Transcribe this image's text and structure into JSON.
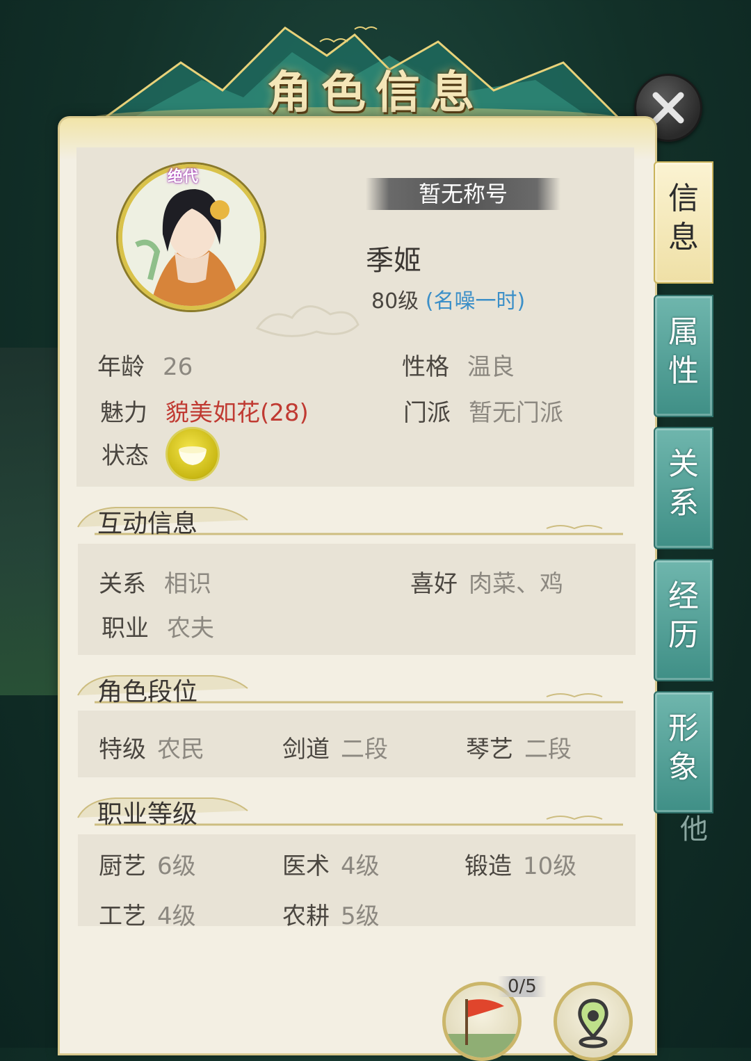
{
  "window": {
    "title": "角色信息"
  },
  "profile": {
    "rarity": "绝代",
    "title_banner": "暂无称号",
    "name": "季姬",
    "level": "80级",
    "fame": "(名噪一时)"
  },
  "attributes": {
    "age_label": "年龄",
    "age_value": "26",
    "personality_label": "性格",
    "personality_value": "温良",
    "charm_label": "魅力",
    "charm_value": "貌美如花(28)",
    "sect_label": "门派",
    "sect_value": "暂无门派",
    "status_label": "状态"
  },
  "interaction": {
    "title": "互动信息",
    "relation_label": "关系",
    "relation_value": "相识",
    "likes_label": "喜好",
    "likes_value": "肉菜、鸡",
    "job_label": "职业",
    "job_value": "农夫"
  },
  "ranks": {
    "title": "角色段位",
    "items": [
      {
        "label": "特级",
        "value": "农民"
      },
      {
        "label": "剑道",
        "value": "二段"
      },
      {
        "label": "琴艺",
        "value": "二段"
      }
    ]
  },
  "job_levels": {
    "title": "职业等级",
    "items": [
      {
        "label": "厨艺",
        "value": "6级"
      },
      {
        "label": "医术",
        "value": "4级"
      },
      {
        "label": "锻造",
        "value": "10级"
      },
      {
        "label": "工艺",
        "value": "4级"
      },
      {
        "label": "农耕",
        "value": "5级"
      }
    ]
  },
  "tabs": [
    {
      "label": "信息",
      "active": true
    },
    {
      "label": "属性",
      "active": false
    },
    {
      "label": "关系",
      "active": false
    },
    {
      "label": "经历",
      "active": false
    },
    {
      "label": "形象",
      "active": false
    }
  ],
  "tab_hidden_label": "他",
  "bottom": {
    "flag_count": "0/5"
  },
  "colors": {
    "accent_gold": "#d9c24a",
    "tab_teal": "#3f8f86",
    "fame_blue": "#3b8fc8",
    "charm_red": "#c03a32"
  }
}
